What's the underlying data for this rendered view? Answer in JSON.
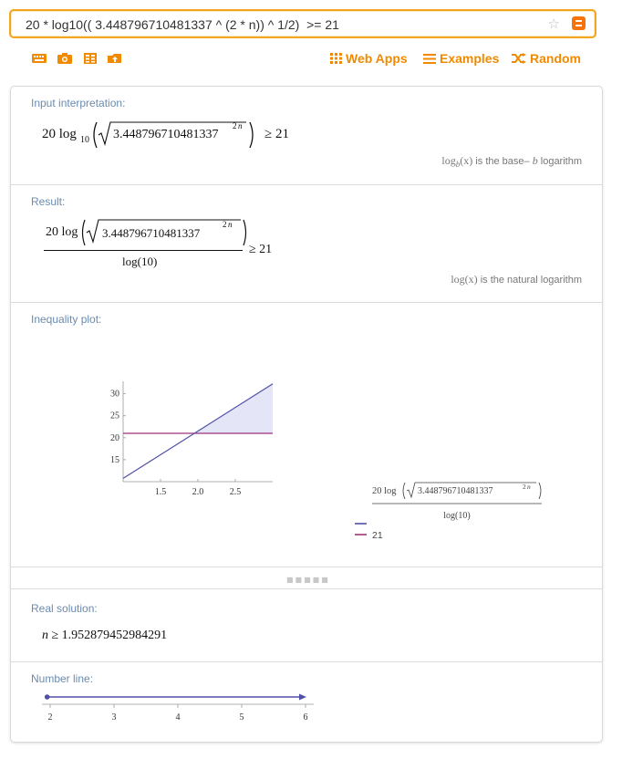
{
  "search": {
    "query": "20 * log10(( 3.448796710481337 ^ (2 * n)) ^ 1/2)  >= 21"
  },
  "toolbar": {
    "tools": [
      "keyboard-icon",
      "camera-icon",
      "table-icon",
      "upload-icon"
    ],
    "links": [
      {
        "label": "Web Apps",
        "icon": "grid-icon"
      },
      {
        "label": "Examples",
        "icon": "list-icon"
      },
      {
        "label": "Random",
        "icon": "shuffle-icon"
      }
    ]
  },
  "colors": {
    "accent": "#f08a00",
    "border": "#f2a51f",
    "title": "#6a8bae",
    "series1": "#5050a8",
    "series2": "#a0327d",
    "fill": "#dcdcf5"
  },
  "pods": {
    "input": {
      "title": "Input interpretation:",
      "coef": "20 log",
      "sub": "10",
      "base": "3.448796710481337",
      "exp": "2",
      "var": "n",
      "rhs": "≥ 21",
      "note_pre": "log",
      "note_sub": "b",
      "note_arg": "(x)",
      "note_text": " is the base– ",
      "note_b": "b",
      "note_end": " logarithm"
    },
    "result": {
      "title": "Result:",
      "num": "20 log",
      "base": "3.448796710481337",
      "exp": "2",
      "var": "n",
      "den": "log(10)",
      "rhs": "≥ 21",
      "note_pre": "log",
      "note_arg": "(x)",
      "note_text": " is the natural logarithm"
    },
    "plot": {
      "title": "Inequality plot:"
    },
    "solution": {
      "title": "Real solution:",
      "var": "n",
      "text": " ≥ 1.952879452984291"
    },
    "numberline": {
      "title": "Number line:"
    }
  },
  "chart_data": [
    {
      "type": "line",
      "title": "",
      "xlabel": "",
      "ylabel": "",
      "xlim": [
        1.0,
        3.0
      ],
      "ylim": [
        10,
        32
      ],
      "xticks": [
        1.5,
        2.0,
        2.5
      ],
      "yticks": [
        15,
        20,
        25,
        30
      ],
      "series": [
        {
          "name": "20 log(√(3.448796710481337^(2 n)))/log(10)",
          "x": [
            1.0,
            3.0
          ],
          "y": [
            10.75,
            32.26
          ],
          "color": "#5050a8"
        },
        {
          "name": "21",
          "x": [
            1.0,
            3.0
          ],
          "y": [
            21,
            21
          ],
          "color": "#a0327d"
        }
      ],
      "shaded_region": "between series where first ≥ 21",
      "legend": "right",
      "grid": false
    },
    {
      "type": "line",
      "title": "",
      "xlim": [
        1.9,
        6.1
      ],
      "xticks": [
        2,
        3,
        4,
        5,
        6
      ],
      "solution_start": 1.952879452984291,
      "direction": "right",
      "closed_endpoint": true
    }
  ]
}
